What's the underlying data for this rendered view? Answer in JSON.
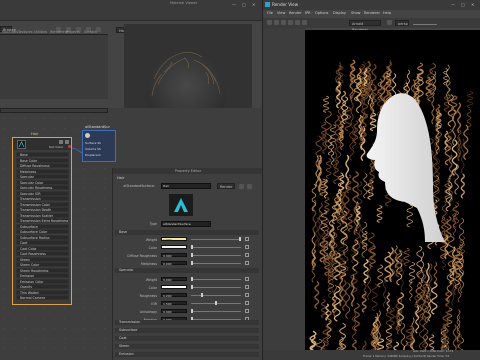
{
  "left_panel": {
    "tab_active": "Browse",
    "browser_tabs": [
      "Materials",
      "Textures",
      "Utilities",
      "Rendering",
      "Projects",
      "Scratch"
    ],
    "swatch_title": "Material Viewer",
    "toolbar_dropdowns": [
      "Hardware",
      "Sphere",
      "aiStandardSurface"
    ]
  },
  "node": {
    "title": "Hair",
    "out_color_label": "Out Color",
    "attributes": [
      "Base",
      "Base Color",
      "Diffuse Roughness",
      "Metalness",
      "Specular",
      "Specular Color",
      "Specular Roughness",
      "Specular IOR",
      "Transmission",
      "Transmission Color",
      "Transmission Depth",
      "Transmission Scatter",
      "Transmission Extra Roughness",
      "Subsurface",
      "Subsurface Color",
      "Subsurface Radius",
      "Coat",
      "Coat Color",
      "Coat Roughness",
      "Sheen",
      "Sheen Color",
      "Sheen Roughness",
      "Emission",
      "Emission Color",
      "Opacity",
      "Thin Walled",
      "Normal Camera"
    ]
  },
  "node2": {
    "title": "aiStandardSur",
    "rows": [
      "Surface Sh",
      "Volume Sh",
      "Displacem"
    ]
  },
  "property_editor": {
    "title": "Property Editor",
    "tab": "Hair",
    "shader_label": "aiStandardSurface:",
    "shader_name": "Hair",
    "render_btn": "Render",
    "type_label": "Type",
    "type_value": "aiStandardSurface",
    "sections": {
      "base": "Base",
      "specular": "Specular",
      "transmission": "Transmission",
      "subsurface": "Subsurface",
      "coat": "Coat",
      "sheen": "Sheen",
      "emission": "Emission"
    },
    "base_rows": [
      {
        "label": "Weight",
        "value": "1.000",
        "highlight": true
      },
      {
        "label": "Color",
        "value": ""
      },
      {
        "label": "Diffuse Roughness",
        "value": "0.000"
      },
      {
        "label": "Metalness",
        "value": "0.000"
      }
    ],
    "spec_rows": [
      {
        "label": "Weight",
        "value": "0.000"
      },
      {
        "label": "Color",
        "value": ""
      },
      {
        "label": "Roughness",
        "value": "0.200"
      },
      {
        "label": "IOR",
        "value": "1.500"
      },
      {
        "label": "Anisotropy",
        "value": "0.000"
      },
      {
        "label": "Rotation",
        "value": "0.000"
      }
    ]
  },
  "render_view": {
    "title": "Render View",
    "menus": [
      "File",
      "View",
      "Render",
      "IPR",
      "Options",
      "Display",
      "Show",
      "Renderer",
      "Help"
    ],
    "camera": "persp",
    "renderer": "Arnold Renderer",
    "status": "size: 1920 x 1080 zoom: 0.172",
    "status2": "Frame: 1  Memory: 4466Mb  Sampling: [3/2/2/2/2]  Render Time: 3:0"
  },
  "window_controls": [
    "—",
    "□",
    "✕"
  ],
  "colors": {
    "node_border": "#e3a13b",
    "highlight_field": "#f2e7a0",
    "node2_border": "#3b6fbf"
  }
}
